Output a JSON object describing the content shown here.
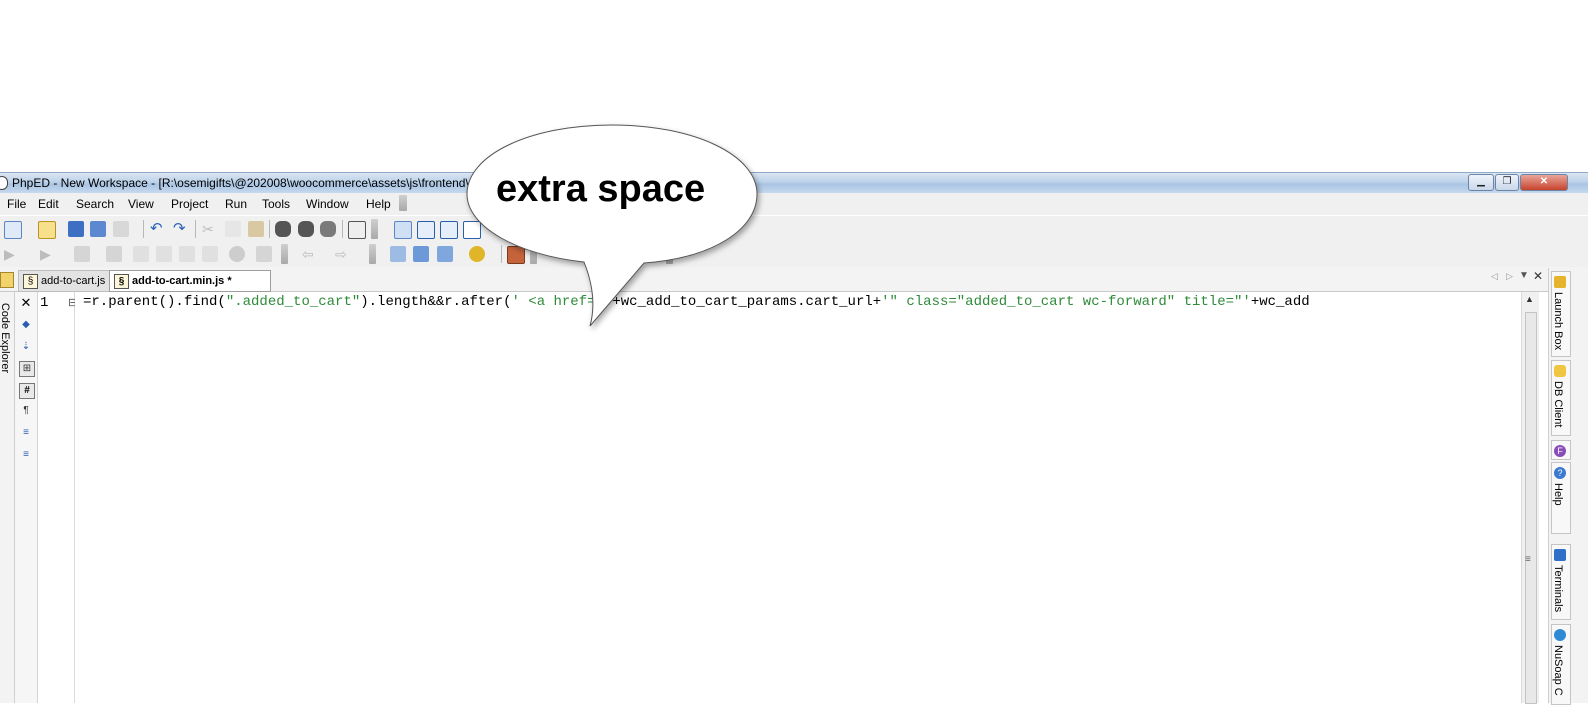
{
  "window": {
    "title": "PhpED - New Workspace - [R:\\osemigifts\\@202008\\woocommerce\\assets\\js\\frontend\\",
    "controls": {
      "minimize": "▁",
      "restore": "❐",
      "close": "✕"
    }
  },
  "menu": [
    "File",
    "Edit",
    "Search",
    "View",
    "Project",
    "Run",
    "Tools",
    "Window",
    "Help"
  ],
  "tabs": [
    {
      "label": "add-to-cart.js",
      "active": false
    },
    {
      "label": "add-to-cart.min.js *",
      "active": true
    }
  ],
  "left_panel": {
    "label": "Code Explorer"
  },
  "editor": {
    "line_number": "1",
    "close_glyph": "✕",
    "fold_glyph": "⊟",
    "code_prefix": "=r.parent().find(",
    "code_str1": "\".added_to_cart\"",
    "code_mid": ").length&&r.after(",
    "code_str2": "' <a href=\"'",
    "code_mid2": "+wc_add_to_cart_params.cart_url+",
    "code_str3": "'\" class=\"added_to_cart wc-forward\" title=\"'",
    "code_tail": "+wc_add"
  },
  "right_panel": [
    "Launch Box",
    "DB Client",
    "Help",
    "Terminals",
    "NuSoap C"
  ],
  "callout": {
    "text": "extra space"
  },
  "colors": {
    "string": "#2e8b3a",
    "titlebar": "#bcd2ea"
  }
}
